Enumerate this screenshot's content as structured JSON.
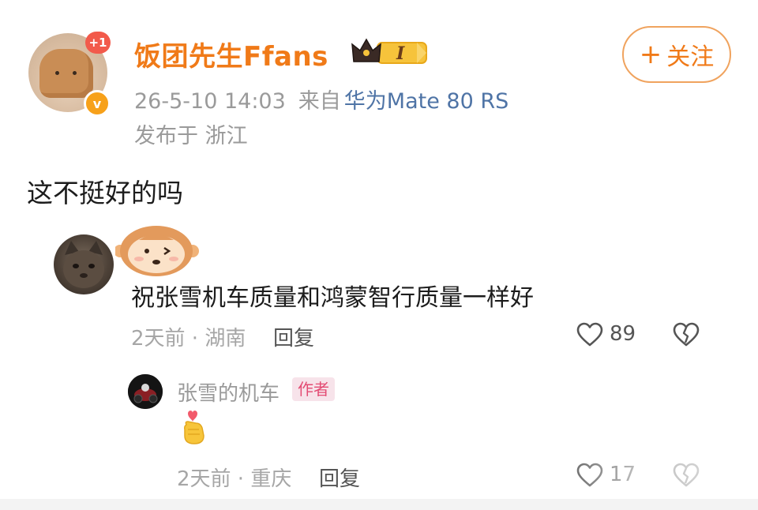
{
  "post": {
    "author": "饭团先生Ffans",
    "new_badge": "+1",
    "vip_level": "I",
    "verified_mark": "v",
    "timestamp": "26-5-10 14:03",
    "source_prefix": "来自",
    "source_device": "华为Mate 80 RS",
    "location": "发布于 浙江",
    "follow_label": "关注",
    "text": "这不挺好的吗"
  },
  "comment": {
    "text": "祝张雪机车质量和鸿蒙智行质量一样好",
    "time_location": "2天前 · 湖南",
    "reply_label": "回复",
    "like_count": "89"
  },
  "reply": {
    "author": "张雪的机车",
    "author_tag": "作者",
    "time_location": "2天前 · 重庆",
    "reply_label": "回复",
    "like_count": "17"
  },
  "icons": {
    "crown": "crown-icon",
    "plus": "plus-icon",
    "like": "heart-outline-icon",
    "dislike": "broken-heart-icon",
    "heart_hand": "finger-heart-emoji",
    "monkey": "monkey-sticker-icon"
  },
  "colors": {
    "accent_orange": "#f07a18",
    "device_blue": "#4f74a6",
    "author_tag_bg": "#f7e3ea",
    "author_tag_text": "#e34b73",
    "badge_red": "#f25a4b"
  }
}
